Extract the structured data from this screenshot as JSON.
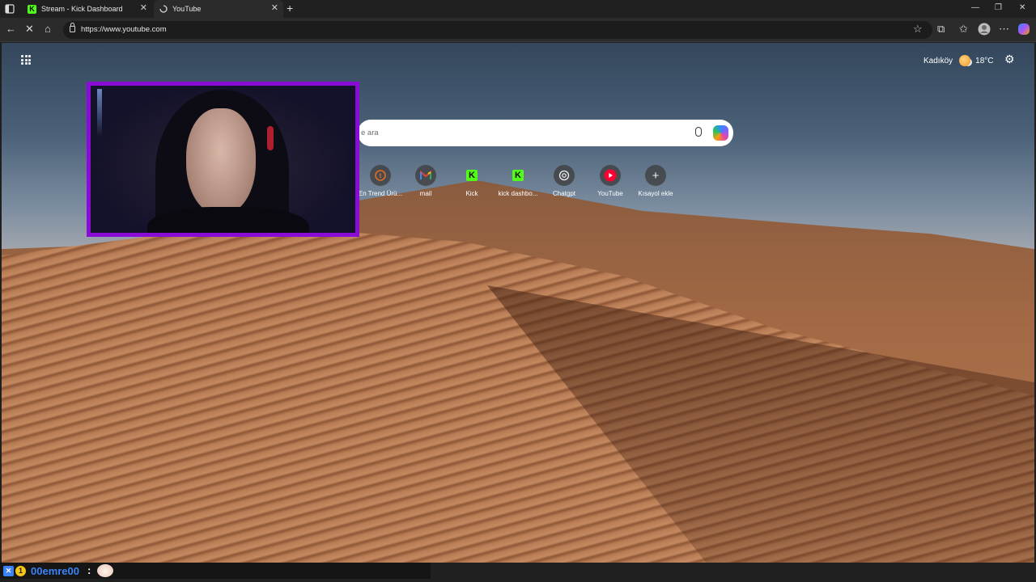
{
  "browser": {
    "tabs": [
      {
        "label": "Stream - Kick Dashboard",
        "favicon": "kick-icon"
      },
      {
        "label": "YouTube",
        "favicon": "loading-icon"
      }
    ],
    "url": "https://www.youtube.com"
  },
  "newtab": {
    "location": "Kadıköy",
    "temperature": "18°C",
    "search_placeholder": "e ara",
    "shortcuts": [
      {
        "label": "En Trend Ürü...",
        "icon": "trend-icon"
      },
      {
        "label": "mail",
        "icon": "gmail-icon"
      },
      {
        "label": "Kick",
        "icon": "kick-icon"
      },
      {
        "label": "kick dashbo...",
        "icon": "kick-icon"
      },
      {
        "label": "Chatgpt",
        "icon": "chatgpt-icon"
      },
      {
        "label": "YouTube",
        "icon": "youtube-icon"
      },
      {
        "label": "Kısayol ekle",
        "icon": "plus-icon"
      }
    ]
  },
  "chat": {
    "username": "00emre00",
    "separator": ":"
  },
  "colors": {
    "kick_green": "#53fc18",
    "cam_border": "#8a0bd6",
    "username": "#3b82f6"
  }
}
